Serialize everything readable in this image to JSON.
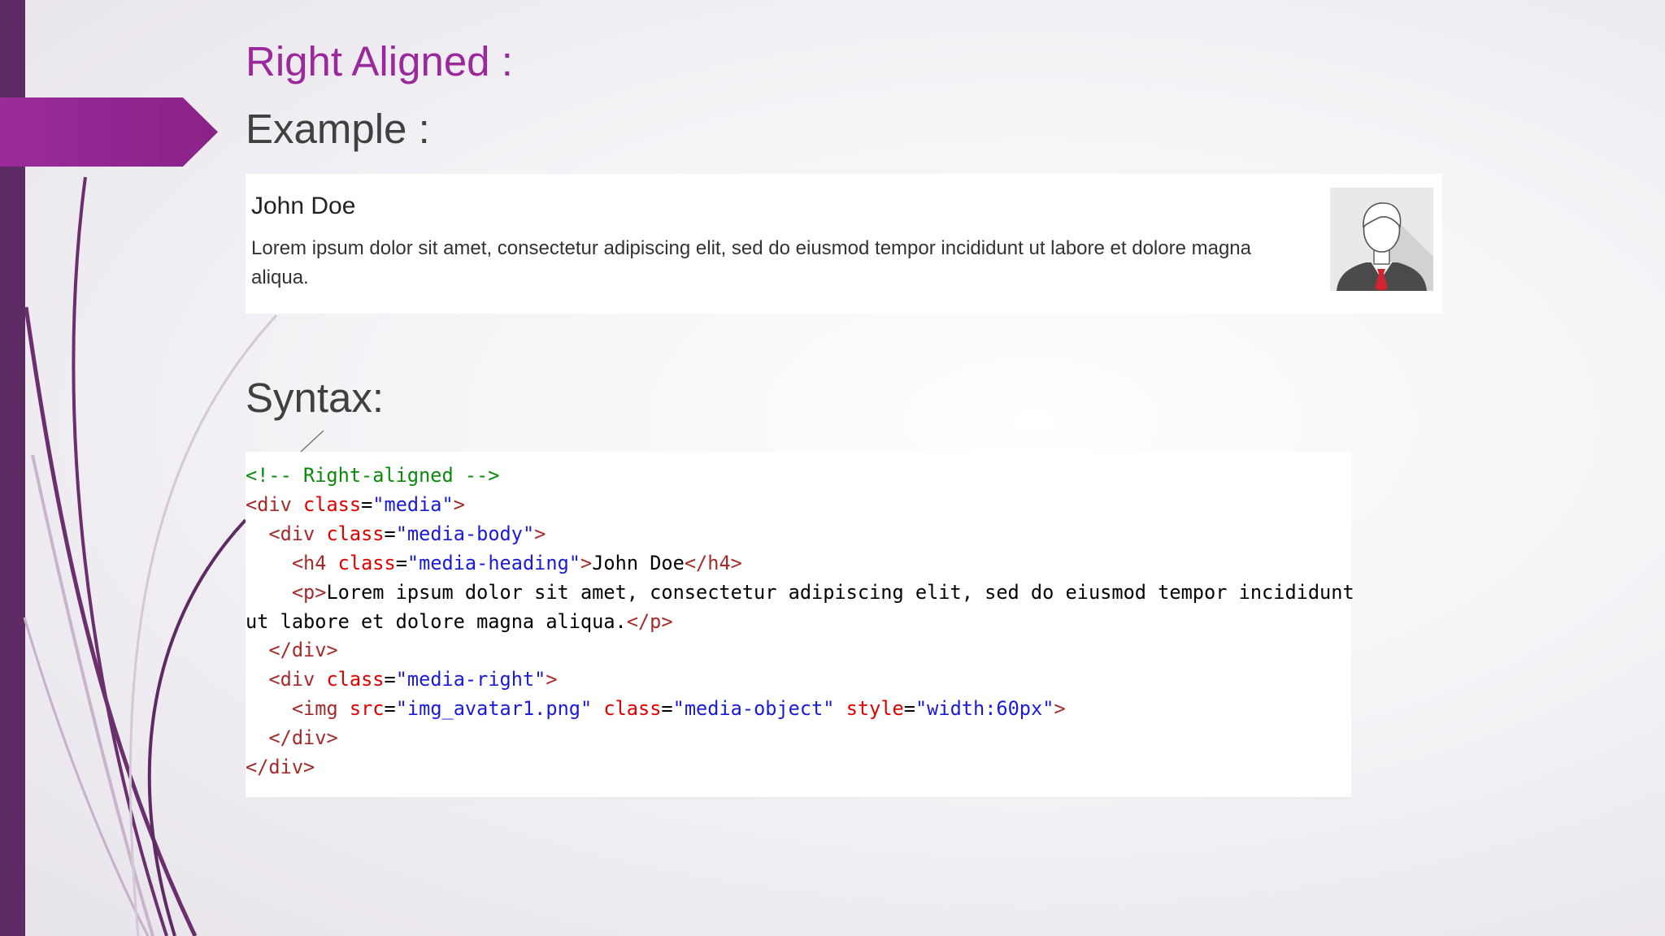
{
  "slide": {
    "title": "Right Aligned :",
    "example_heading": "Example :",
    "syntax_heading": "Syntax:"
  },
  "example": {
    "name": "John Doe",
    "text": "Lorem ipsum dolor sit amet, consectetur adipiscing elit, sed do eiusmod tempor incididunt ut labore et dolore magna aliqua.",
    "image": "avatar-icon"
  },
  "code": {
    "lines": [
      [
        {
          "t": "cm",
          "s": "<!-- Right-aligned -->"
        }
      ],
      [
        {
          "t": "tg",
          "s": "<div"
        },
        {
          "t": "at",
          "s": " class"
        },
        {
          "t": "tx",
          "s": "="
        },
        {
          "t": "vl",
          "s": "\"media\""
        },
        {
          "t": "tg",
          "s": ">"
        }
      ],
      [
        {
          "t": "tx",
          "s": "  "
        },
        {
          "t": "tg",
          "s": "<div"
        },
        {
          "t": "at",
          "s": " class"
        },
        {
          "t": "tx",
          "s": "="
        },
        {
          "t": "vl",
          "s": "\"media-body\""
        },
        {
          "t": "tg",
          "s": ">"
        }
      ],
      [
        {
          "t": "tx",
          "s": "    "
        },
        {
          "t": "tg",
          "s": "<h4"
        },
        {
          "t": "at",
          "s": " class"
        },
        {
          "t": "tx",
          "s": "="
        },
        {
          "t": "vl",
          "s": "\"media-heading\""
        },
        {
          "t": "tg",
          "s": ">"
        },
        {
          "t": "tx",
          "s": "John Doe"
        },
        {
          "t": "tg",
          "s": "</h4>"
        }
      ],
      [
        {
          "t": "tx",
          "s": "    "
        },
        {
          "t": "tg",
          "s": "<p>"
        },
        {
          "t": "tx",
          "s": "Lorem ipsum dolor sit amet, consectetur adipiscing elit, sed do eiusmod tempor incididunt"
        }
      ],
      [
        {
          "t": "tx",
          "s": "ut labore et dolore magna aliqua."
        },
        {
          "t": "tg",
          "s": "</p>"
        }
      ],
      [
        {
          "t": "tx",
          "s": "  "
        },
        {
          "t": "tg",
          "s": "</div>"
        }
      ],
      [
        {
          "t": "tx",
          "s": "  "
        },
        {
          "t": "tg",
          "s": "<div"
        },
        {
          "t": "at",
          "s": " class"
        },
        {
          "t": "tx",
          "s": "="
        },
        {
          "t": "vl",
          "s": "\"media-right\""
        },
        {
          "t": "tg",
          "s": ">"
        }
      ],
      [
        {
          "t": "tx",
          "s": "    "
        },
        {
          "t": "tg",
          "s": "<img"
        },
        {
          "t": "at",
          "s": " src"
        },
        {
          "t": "tx",
          "s": "="
        },
        {
          "t": "vl",
          "s": "\"img_avatar1.png\""
        },
        {
          "t": "at",
          "s": " class"
        },
        {
          "t": "tx",
          "s": "="
        },
        {
          "t": "vl",
          "s": "\"media-object\""
        },
        {
          "t": "at",
          "s": " style"
        },
        {
          "t": "tx",
          "s": "="
        },
        {
          "t": "vl",
          "s": "\"width:60px\""
        },
        {
          "t": "tg",
          "s": ">"
        }
      ],
      [
        {
          "t": "tx",
          "s": "  "
        },
        {
          "t": "tg",
          "s": "</div>"
        }
      ],
      [
        {
          "t": "tg",
          "s": "</div>"
        }
      ]
    ]
  },
  "colors": {
    "accent": "#9a2a9c",
    "sidebar": "#5e2a64",
    "heading": "#404040",
    "code_comment": "#0a8a0a",
    "code_tag": "#a52a2a",
    "code_attr": "#e00000",
    "code_value": "#1a1ad9"
  }
}
